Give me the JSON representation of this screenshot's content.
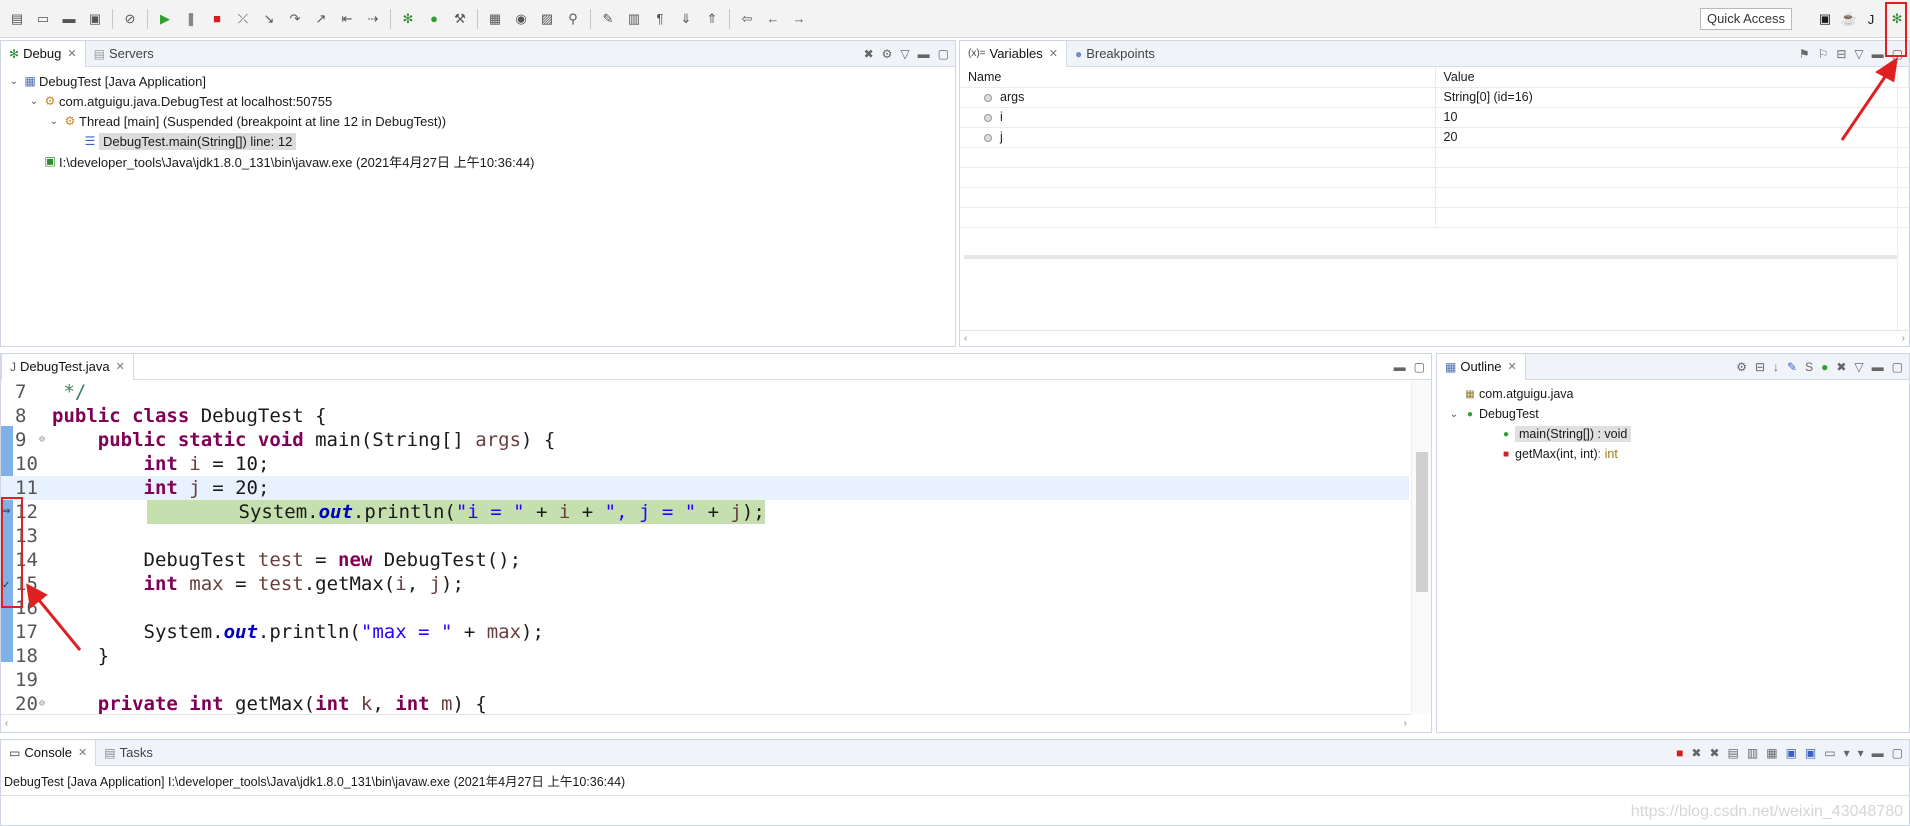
{
  "toolbar": {
    "quick_access": "Quick Access",
    "icons": [
      "new-icon",
      "save-icon",
      "save-all-icon",
      "print-icon",
      "skip-breakpoints-icon",
      "resume-icon",
      "suspend-icon",
      "terminate-icon",
      "disconnect-icon",
      "step-into-icon",
      "step-over-icon",
      "step-return-icon",
      "drop-to-frame-icon",
      "use-step-filters-icon",
      "debug-icon",
      "run-icon",
      "external-tools-icon",
      "new-java-package-icon",
      "new-java-class-icon",
      "open-type-icon",
      "search-icon",
      "toggle-mark-occurrences-icon",
      "toggle-block-selection-icon",
      "show-whitespace-icon",
      "next-annotation-icon",
      "previous-annotation-icon",
      "last-edit-icon",
      "back-icon",
      "forward-icon"
    ]
  },
  "debug_view": {
    "tabs": [
      {
        "label": "Debug",
        "active": true
      },
      {
        "label": "Servers",
        "active": false
      }
    ],
    "tree": [
      {
        "text": "DebugTest [Java Application]",
        "level": 0,
        "icon": "launch-icon"
      },
      {
        "text": "com.atguigu.java.DebugTest at localhost:50755",
        "level": 1,
        "icon": "vm-icon"
      },
      {
        "text": "Thread [main] (Suspended (breakpoint at line 12 in DebugTest))",
        "level": 2,
        "icon": "thread-icon"
      },
      {
        "text": "DebugTest.main(String[]) line: 12",
        "level": 3,
        "icon": "stack-frame-icon",
        "selected": true
      },
      {
        "text": "I:\\developer_tools\\Java\\jdk1.8.0_131\\bin\\javaw.exe (2021年4月27日 上午10:36:44)",
        "level": 1,
        "icon": "process-icon"
      }
    ]
  },
  "variables_view": {
    "tabs": [
      {
        "label": "Variables",
        "prefix": "(x)=",
        "active": true
      },
      {
        "label": "Breakpoints",
        "active": false
      }
    ],
    "columns": [
      "Name",
      "Value"
    ],
    "rows": [
      {
        "name": "args",
        "value": "String[0]  (id=16)"
      },
      {
        "name": "i",
        "value": "10"
      },
      {
        "name": "j",
        "value": "20"
      }
    ]
  },
  "editor": {
    "tab": "DebugTest.java",
    "line_numbers": [
      "7",
      "8",
      "9",
      "10",
      "11",
      "12",
      "13",
      "14",
      "15",
      "16",
      "17",
      "18",
      "19",
      "20"
    ],
    "lines": [
      [
        {
          "t": " */",
          "c": "cm"
        }
      ],
      [
        {
          "t": "public class",
          "c": "kw"
        },
        {
          "t": " DebugTest {",
          "c": ""
        }
      ],
      [
        {
          "t": "    ",
          "c": ""
        },
        {
          "t": "public static void",
          "c": "kw"
        },
        {
          "t": " main(String[] ",
          "c": ""
        },
        {
          "t": "args",
          "c": "var"
        },
        {
          "t": ") {",
          "c": ""
        }
      ],
      [
        {
          "t": "        ",
          "c": ""
        },
        {
          "t": "int",
          "c": "kw"
        },
        {
          "t": " ",
          "c": ""
        },
        {
          "t": "i",
          "c": "var"
        },
        {
          "t": " = 10;",
          "c": ""
        }
      ],
      [
        {
          "t": "        ",
          "c": ""
        },
        {
          "t": "int",
          "c": "kw"
        },
        {
          "t": " ",
          "c": ""
        },
        {
          "t": "j",
          "c": "var"
        },
        {
          "t": " = 20;",
          "c": ""
        }
      ],
      [
        {
          "t": "        System.",
          "c": ""
        },
        {
          "t": "out",
          "c": "fld"
        },
        {
          "t": ".println(",
          "c": ""
        },
        {
          "t": "\"i = \"",
          "c": "str"
        },
        {
          "t": " + ",
          "c": ""
        },
        {
          "t": "i",
          "c": "var"
        },
        {
          "t": " + ",
          "c": ""
        },
        {
          "t": "\", j = \"",
          "c": "str"
        },
        {
          "t": " + ",
          "c": ""
        },
        {
          "t": "j",
          "c": "var"
        },
        {
          "t": ");",
          "c": ""
        }
      ],
      [],
      [
        {
          "t": "        DebugTest ",
          "c": ""
        },
        {
          "t": "test",
          "c": "var"
        },
        {
          "t": " = ",
          "c": ""
        },
        {
          "t": "new",
          "c": "kw"
        },
        {
          "t": " DebugTest();",
          "c": ""
        }
      ],
      [
        {
          "t": "        ",
          "c": ""
        },
        {
          "t": "int",
          "c": "kw"
        },
        {
          "t": " ",
          "c": ""
        },
        {
          "t": "max",
          "c": "var"
        },
        {
          "t": " = ",
          "c": ""
        },
        {
          "t": "test",
          "c": "var"
        },
        {
          "t": ".getMax(",
          "c": ""
        },
        {
          "t": "i",
          "c": "var"
        },
        {
          "t": ", ",
          "c": ""
        },
        {
          "t": "j",
          "c": "var"
        },
        {
          "t": ");",
          "c": ""
        }
      ],
      [],
      [
        {
          "t": "        System.",
          "c": ""
        },
        {
          "t": "out",
          "c": "fld"
        },
        {
          "t": ".println(",
          "c": ""
        },
        {
          "t": "\"max = \"",
          "c": "str"
        },
        {
          "t": " + ",
          "c": ""
        },
        {
          "t": "max",
          "c": "var"
        },
        {
          "t": ");",
          "c": ""
        }
      ],
      [
        {
          "t": "    }",
          "c": ""
        }
      ],
      [],
      [
        {
          "t": "    ",
          "c": ""
        },
        {
          "t": "private int",
          "c": "kw"
        },
        {
          "t": " getMax(",
          "c": ""
        },
        {
          "t": "int",
          "c": "kw"
        },
        {
          "t": " ",
          "c": ""
        },
        {
          "t": "k",
          "c": "var"
        },
        {
          "t": ", ",
          "c": ""
        },
        {
          "t": "int",
          "c": "kw"
        },
        {
          "t": " ",
          "c": ""
        },
        {
          "t": "m",
          "c": "var"
        },
        {
          "t": ") {",
          "c": ""
        }
      ]
    ]
  },
  "outline_view": {
    "tab": "Outline",
    "items": [
      {
        "text": "com.atguigu.java",
        "level": 0,
        "icon": "package-icon"
      },
      {
        "text": "DebugTest",
        "level": 0,
        "icon": "class-icon",
        "expanded": true
      },
      {
        "text": "main(String[]) : void",
        "level": 1,
        "icon": "public-method-icon",
        "selected": true
      },
      {
        "text": "getMax(int, int)",
        "suffix": " : int",
        "level": 1,
        "icon": "private-method-icon"
      }
    ]
  },
  "console_view": {
    "tabs": [
      {
        "label": "Console",
        "active": true
      },
      {
        "label": "Tasks",
        "active": false
      }
    ],
    "text": "DebugTest [Java Application] I:\\developer_tools\\Java\\jdk1.8.0_131\\bin\\javaw.exe (2021年4月27日 上午10:36:44)"
  },
  "watermark": "https://blog.csdn.net/weixin_43048780"
}
